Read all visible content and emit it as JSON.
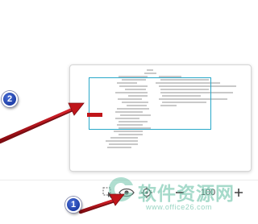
{
  "callouts": {
    "one": "1",
    "two": "2"
  },
  "toolbar": {
    "select_icon": "select-cursor-icon",
    "eye_icon": "eye-icon",
    "locate_icon": "target-icon",
    "minus_icon": "minus-icon",
    "zoom_value": "100",
    "plus_icon": "plus-icon"
  },
  "navigator": {
    "frame_color": "#29a8c9",
    "marker_color": "#c0151a"
  },
  "watermark": {
    "text": "软件资源网",
    "url": "www.office26.com"
  },
  "colors": {
    "badge": "#1f3fa8",
    "arrow": "#c0151a"
  }
}
